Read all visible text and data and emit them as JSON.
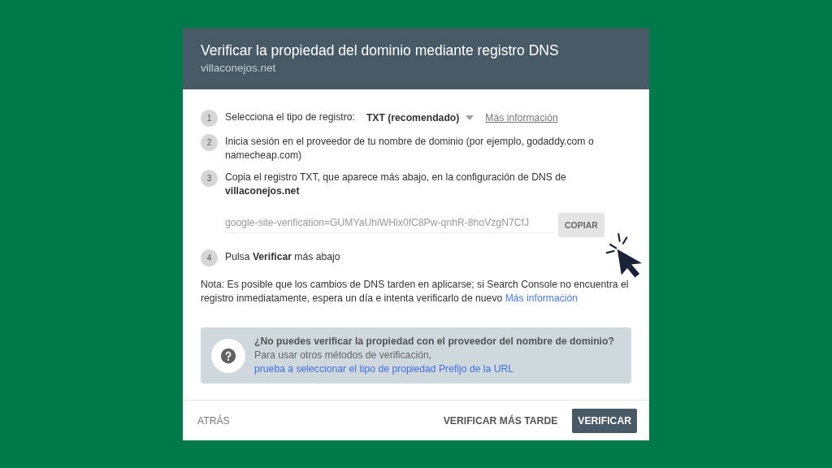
{
  "dialog": {
    "title": "Verificar la propiedad del dominio mediante registro DNS",
    "subtitle": "villaconejos.net"
  },
  "steps": [
    {
      "number": "1",
      "kind": "select",
      "text": "Selecciona el tipo de registro:",
      "select_value": "TXT (recomendado)",
      "link": "Más información"
    },
    {
      "number": "2",
      "kind": "text",
      "text": "Inicia sesión en el proveedor de tu nombre de dominio (por ejemplo, godaddy.com o namecheap.com)"
    },
    {
      "number": "3",
      "kind": "record",
      "text": "Copia el registro TXT, que aparece más abajo, en la configuración de DNS de **villaconejos.net**",
      "record": "google-site-verification=GUMYaUhiWHix0fC8Pw-qnhR-8hoVzgN7CfJ",
      "copy_button": "COPIAR"
    },
    {
      "number": "4",
      "kind": "text",
      "text": "Pulsa **Verificar** más abajo"
    }
  ],
  "note": {
    "text": "Nota: Es posible que los cambios de DNS tarden en aplicarse; si Search Console no encuentra el registro inmediatamente, espera un día e intenta verificarlo de nuevo",
    "link": "Más información"
  },
  "help": {
    "title": "¿No puedes verificar la propiedad con el proveedor del nombre de dominio?",
    "text": "Para usar otros métodos de verificación,",
    "link": "prueba a seleccionar el tipo de propiedad Prefijo de la URL"
  },
  "footer": {
    "back": "ATRÁS",
    "later": "VERIFICAR MÁS TARDE",
    "verify": "VERIFICAR"
  }
}
